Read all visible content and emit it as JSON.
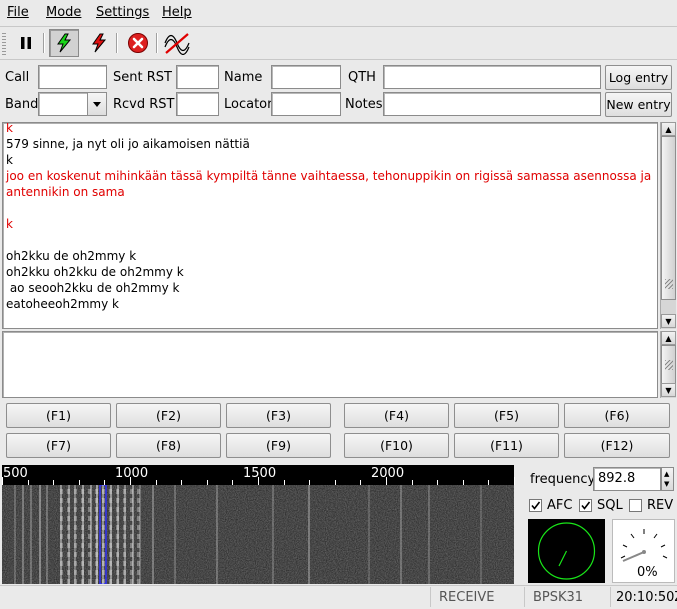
{
  "menu": [
    "File",
    "Mode",
    "Settings",
    "Help"
  ],
  "menu_mnemonic_index": [
    0,
    0,
    0,
    0
  ],
  "toolbar": {
    "buttons": [
      "pause-icon",
      "tx-lightning-green-icon",
      "tx-lightning-red-icon",
      "abort-icon",
      "spectrum-icon"
    ]
  },
  "form": {
    "call_label": "Call",
    "call_value": "",
    "sent_rst_label": "Sent RST",
    "sent_rst_value": "",
    "name_label": "Name",
    "name_value": "",
    "qth_label": "QTH",
    "qth_value": "",
    "log_entry_label": "Log entry",
    "band_label": "Band",
    "band_value": "",
    "rcvd_rst_label": "Rcvd RST",
    "rcvd_rst_value": "",
    "locator_label": "Locator",
    "locator_value": "",
    "notes_label": "Notes",
    "notes_value": "",
    "new_entry_label": "New entry"
  },
  "rx_text": [
    {
      "text": "k",
      "color": "red"
    },
    {
      "text": "579 sinne, ja nyt oli jo aikamoisen nättiä",
      "color": "black"
    },
    {
      "text": "k",
      "color": "black"
    },
    {
      "text": "joo en koskenut mihinkään tässä kympiltä tänne vaihtaessa, tehonuppikin on rigissä samassa asennossa ja antennikin on sama",
      "color": "red"
    },
    {
      "text": "",
      "color": "black"
    },
    {
      "text": "k",
      "color": "red"
    },
    {
      "text": "",
      "color": "black"
    },
    {
      "text": "oh2kku de oh2mmy k",
      "color": "black"
    },
    {
      "text": "oh2kku oh2kku de oh2mmy k",
      "color": "black"
    },
    {
      "text": " ao seooh2kku de oh2mmy k",
      "color": "black"
    },
    {
      "text": "eatoheeoh2mmy k",
      "color": "black"
    }
  ],
  "tx_text": "",
  "macros": {
    "row1": [
      "(F1)",
      "(F2)",
      "(F3)",
      "(F4)",
      "(F5)",
      "(F6)"
    ],
    "row2": [
      "(F7)",
      "(F8)",
      "(F9)",
      "(F10)",
      "(F11)",
      "(F12)"
    ]
  },
  "waterfall": {
    "ruler_labels": [
      "500",
      "1000",
      "1500",
      "2000"
    ],
    "cursor_frequency_hz": 892.8
  },
  "controls": {
    "frequency_label": "frequency",
    "frequency_value": "892.8",
    "afc_label": "AFC",
    "afc_checked": true,
    "sql_label": "SQL",
    "sql_checked": true,
    "rev_label": "REV",
    "rev_checked": false,
    "meter_value": "0%"
  },
  "status": {
    "state": "RECEIVE",
    "mode": "BPSK31",
    "time": "20:10:50Z"
  },
  "colors": {
    "rx_red": "#e00000",
    "phase_scope_green": "#19e619",
    "waterfall_cursor": "#3030ff"
  }
}
